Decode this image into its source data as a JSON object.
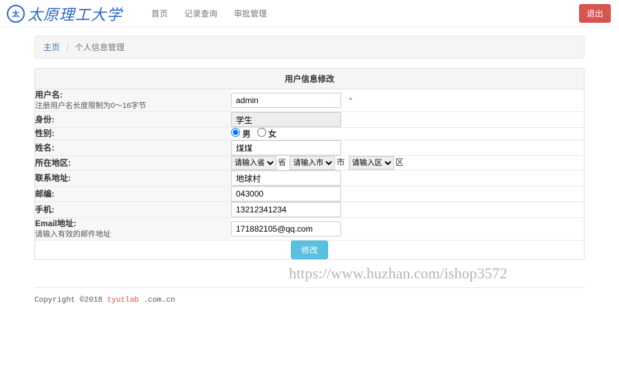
{
  "nav": {
    "brand_text": "太原理工大学",
    "links": {
      "home": "首页",
      "records": "记录查询",
      "approve": "审批管理"
    },
    "logout": "退出"
  },
  "breadcrumb": {
    "home": "主页",
    "current": "个人信息管理"
  },
  "panel": {
    "title": "用户信息修改"
  },
  "form": {
    "username": {
      "label": "用户名:",
      "hint": "注册用户名长度限制为0～16字节",
      "value": "admin"
    },
    "identity": {
      "label": "身份:",
      "value": "学生"
    },
    "gender": {
      "label": "性别:",
      "male": "男",
      "female": "女"
    },
    "realname": {
      "label": "姓名:",
      "value": "煤煤"
    },
    "region": {
      "label": "所在地区:",
      "province_placeholder": "请输入省",
      "province_suffix": "省",
      "city_placeholder": "请输入市",
      "city_suffix": "市",
      "district_placeholder": "请输入区",
      "district_suffix": "区"
    },
    "address": {
      "label": "联系地址:",
      "value": "地球村"
    },
    "postcode": {
      "label": "邮编:",
      "value": "043000"
    },
    "mobile": {
      "label": "手机:",
      "value": "13212341234"
    },
    "email": {
      "label": "Email地址:",
      "hint": "请输入有效的邮件地址",
      "value": "171882105@qq.com"
    },
    "submit": "修改"
  },
  "footer": {
    "copyright": "Copyright ©2018 ",
    "brand": "tyutlab",
    "domain": " .com.cn"
  },
  "watermark": "https://www.huzhan.com/ishop3572"
}
